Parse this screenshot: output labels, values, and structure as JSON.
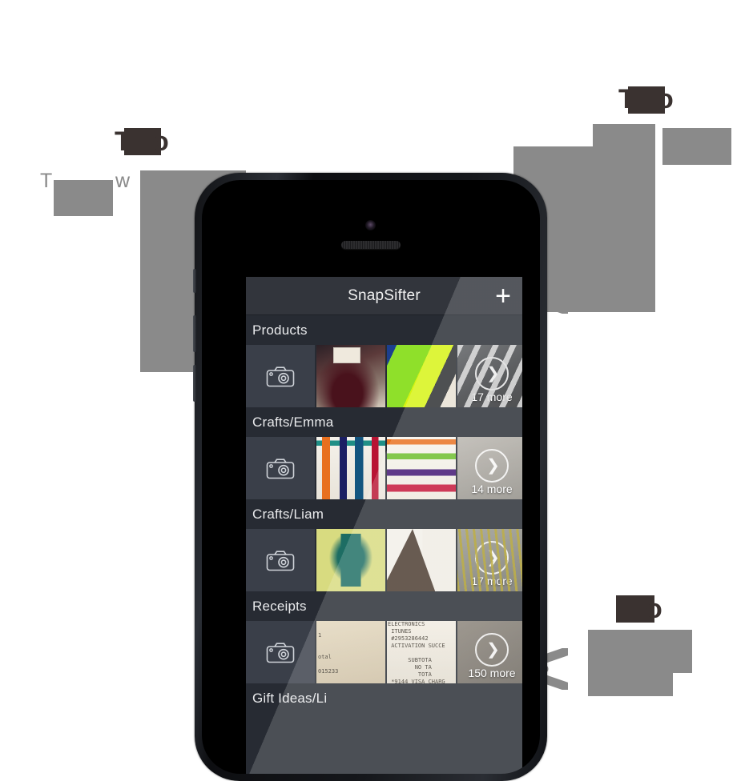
{
  "app": {
    "nav": {
      "title": "SnapSifter",
      "add_label": "+"
    },
    "sections": [
      {
        "title": "Products",
        "camera_icon": "camera-icon",
        "thumbs": [
          "wine-glass-photo",
          "green-soccer-shoe-photo"
        ],
        "more_label": "17 more"
      },
      {
        "title": "Crafts/Emma",
        "camera_icon": "camera-icon",
        "thumbs": [
          "child-painting-stripes-photo",
          "child-painting-zigzag-photo"
        ],
        "more_label": "14 more"
      },
      {
        "title": "Crafts/Liam",
        "camera_icon": "camera-icon",
        "thumbs": [
          "child-drawing-creature-photo",
          "child-drawing-mountain-photo"
        ],
        "more_label": "17 more"
      },
      {
        "title": "Receipts",
        "camera_icon": "camera-icon",
        "thumbs": [
          "blank-receipt-photo",
          "itunes-receipt-photo"
        ],
        "more_label": "150 more",
        "receipt_text_left": "1\n\n\notal\n\n015233",
        "receipt_text_mid": "ELECTRONICS\n ITUNES\n #2953286442\n ACTIVATION SUCCE\n\n      SUBTOTA\n        NO TA\n         TOTA\n *9144 VISA CHARG"
      },
      {
        "title": "Gift Ideas/Li",
        "camera_icon": "camera-icon",
        "thumbs": [],
        "more_label": ""
      }
    ]
  },
  "annotations": {
    "headline_left": "T",
    "headline_left_tail": "o",
    "body_left_start": "T",
    "body_left_mid": "w",
    "headline_right": "T",
    "headline_right_tail": "o",
    "body_right_fragment": "c",
    "headline_bottom": "",
    "headline_bottom_tail": "o"
  },
  "colors": {
    "redact_grey": "#8a8a8a",
    "redact_dark": "#3a3230",
    "screen_bg": "#272b33",
    "navbar_bg": "#32353c",
    "cell_bg": "#3a3f49",
    "text_light": "#e9eaec"
  }
}
